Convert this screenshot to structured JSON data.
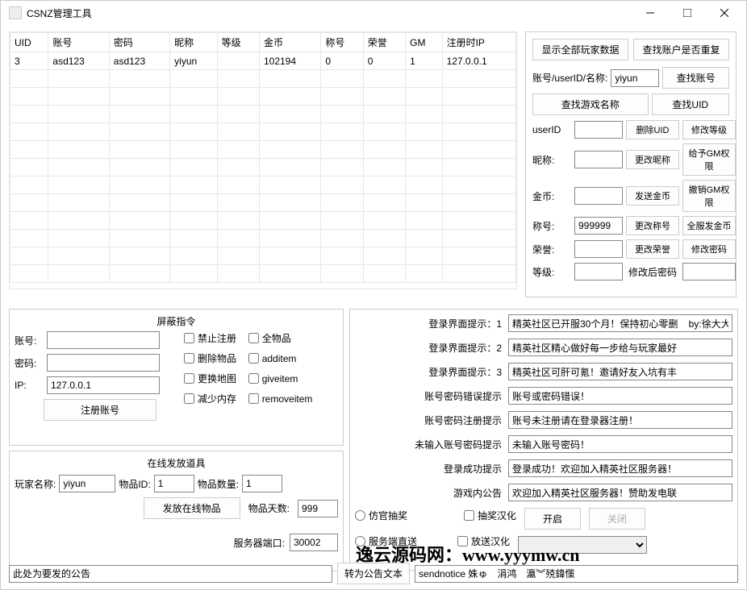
{
  "title": "CSNZ管理工具",
  "table": {
    "headers": [
      "UID",
      "账号",
      "密码",
      "昵称",
      "等级",
      "金币",
      "称号",
      "荣誉",
      "GM",
      "注册时IP"
    ],
    "rows": [
      [
        "3",
        "asd123",
        "asd123",
        "yiyun",
        "",
        "102194",
        "0",
        "0",
        "1",
        "127.0.0.1"
      ]
    ]
  },
  "right": {
    "show_all": "显示全部玩家数据",
    "check_dup": "查找账户是否重复",
    "search_lbl": "账号/userID/名称:",
    "search_val": "yiyun",
    "find_acct": "查找账号",
    "find_game": "查找游戏名称",
    "find_uid": "查找UID",
    "rows": {
      "userID": {
        "lbl": "userID",
        "v": "",
        "b1": "删除UID",
        "b2": "修改等级"
      },
      "nick": {
        "lbl": "昵称:",
        "v": "",
        "b1": "更改昵称",
        "b2": "给予GM权限"
      },
      "gold": {
        "lbl": "金币:",
        "v": "",
        "b1": "发送金币",
        "b2": "撤销GM权限"
      },
      "title": {
        "lbl": "称号:",
        "v": "999999",
        "b1": "更改称号",
        "b2": "全服发金币"
      },
      "honor": {
        "lbl": "荣誉:",
        "v": "",
        "b1": "更改荣誉",
        "b2": "修改密码"
      },
      "level": {
        "lbl": "等级:",
        "v": "",
        "b1": "修改后密码",
        "b2_input": ""
      }
    }
  },
  "block": {
    "hdr": "屏蔽指令",
    "acct": "账号:",
    "pwd": "密码:",
    "ip": "IP:",
    "ip_v": "127.0.0.1",
    "reg_btn": "注册账号",
    "cb": {
      "no_reg": "禁止注册",
      "all_items": "全物品",
      "del_item": "删除物品",
      "additem": "additem",
      "chg_map": "更换地图",
      "giveitem": "giveitem",
      "dec_mem": "减少内存",
      "removeitem": "removeitem"
    }
  },
  "items": {
    "hdr": "在线发放道具",
    "player": "玩家名称:",
    "player_v": "yiyun",
    "id": "物品ID:",
    "id_v": "1",
    "qty": "物品数量:",
    "qty_v": "1",
    "days": "物品天数:",
    "days_v": "999",
    "give": "发放在线物品",
    "port": "服务器端口:",
    "port_v": "30002"
  },
  "msgs": {
    "l1": "登录界面提示：1",
    "v1": "精英社区已开服30个月！保持初心零删    by:徐大大",
    "l2": "登录界面提示：2",
    "v2": "精英社区精心做好每一步给与玩家最好",
    "l3": "登录界面提示：3",
    "v3": "精英社区可肝可氪！邀请好友入坑有丰",
    "l4": "账号密码错误提示",
    "v4": "账号或密码错误！",
    "l5": "账号密码注册提示",
    "v5": "账号未注册请在登录器注册！",
    "l6": "未输入账号密码提示",
    "v6": "未输入账号密码！",
    "l7": "登录成功提示",
    "v7": "登录成功！欢迎加入精英社区服务器！",
    "l8": "游戏内公告",
    "v8": "欢迎加入精英社区服务器！赞助发电联",
    "r1": "仿官抽奖",
    "r2": "服务端直送",
    "c1": "抽奖汉化",
    "c2": "放送汉化",
    "open": "开启",
    "close": "关闭"
  },
  "footer": {
    "notice": "此处为要发的公告",
    "to_text": "转为公告文本",
    "send": "sendnotice 姝ゅ　涓鸿　瀛︾殑鍏憡"
  },
  "watermark": "逸云源码网：www.yyymw.cn"
}
